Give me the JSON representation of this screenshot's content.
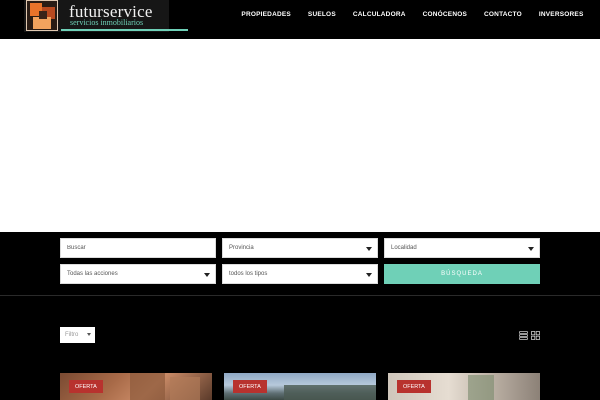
{
  "header": {
    "logo": {
      "title": "futurservice",
      "subtitle": "servicios inmobiliarios"
    },
    "nav": [
      "PROPIEDADES",
      "SUELOS",
      "CALCULADORA",
      "CONÓCENOS",
      "CONTACTO",
      "INVERSORES"
    ]
  },
  "search": {
    "buscar_placeholder": "Buscar",
    "provincia": "Provincia",
    "localidad": "Localidad",
    "acciones": "Todas las acciones",
    "tipos": "todos los tipos",
    "button": "BÚSQUEDA"
  },
  "listing": {
    "filter_label": "Filtro",
    "cards": [
      {
        "badge": "OFERTA"
      },
      {
        "badge": "OFERTA"
      },
      {
        "badge": "OFERTA"
      }
    ]
  },
  "colors": {
    "accent": "#6fd0b7",
    "badge": "#b8322e",
    "background": "#000000",
    "hero": "#ffffff"
  }
}
